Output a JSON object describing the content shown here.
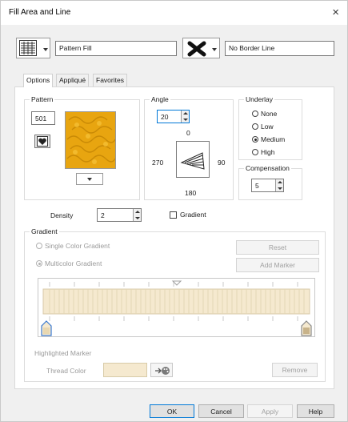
{
  "window": {
    "title": "Fill Area and Line",
    "close_icon": "×"
  },
  "top": {
    "fill_type_value": "Pattern Fill",
    "border_type_value": "No Border Line"
  },
  "tabs": [
    "Options",
    "Appliqué",
    "Favorites"
  ],
  "pattern": {
    "group_label": "Pattern",
    "number": "501",
    "fill_color": "#e8a510"
  },
  "angle": {
    "group_label": "Angle",
    "value": "20",
    "top": "0",
    "left": "270",
    "right": "90",
    "bottom": "180"
  },
  "underlay": {
    "group_label": "Underlay",
    "options": [
      "None",
      "Low",
      "Medium",
      "High"
    ],
    "selected": "Medium"
  },
  "compensation": {
    "group_label": "Compensation",
    "value": "5"
  },
  "density": {
    "label": "Density",
    "value": "2"
  },
  "gradient_check": {
    "label": "Gradient",
    "checked": false
  },
  "gradient": {
    "group_label": "Gradient",
    "single_label": "Single Color Gradient",
    "multi_label": "Multicolor Gradient",
    "reset_label": "Reset",
    "add_marker_label": "Add Marker",
    "highlighted_marker_label": "Highlighted Marker",
    "thread_color_label": "Thread Color",
    "remove_label": "Remove",
    "bar_color": "#f5e9cf"
  },
  "footer": {
    "ok": "OK",
    "cancel": "Cancel",
    "apply": "Apply",
    "help": "Help"
  }
}
